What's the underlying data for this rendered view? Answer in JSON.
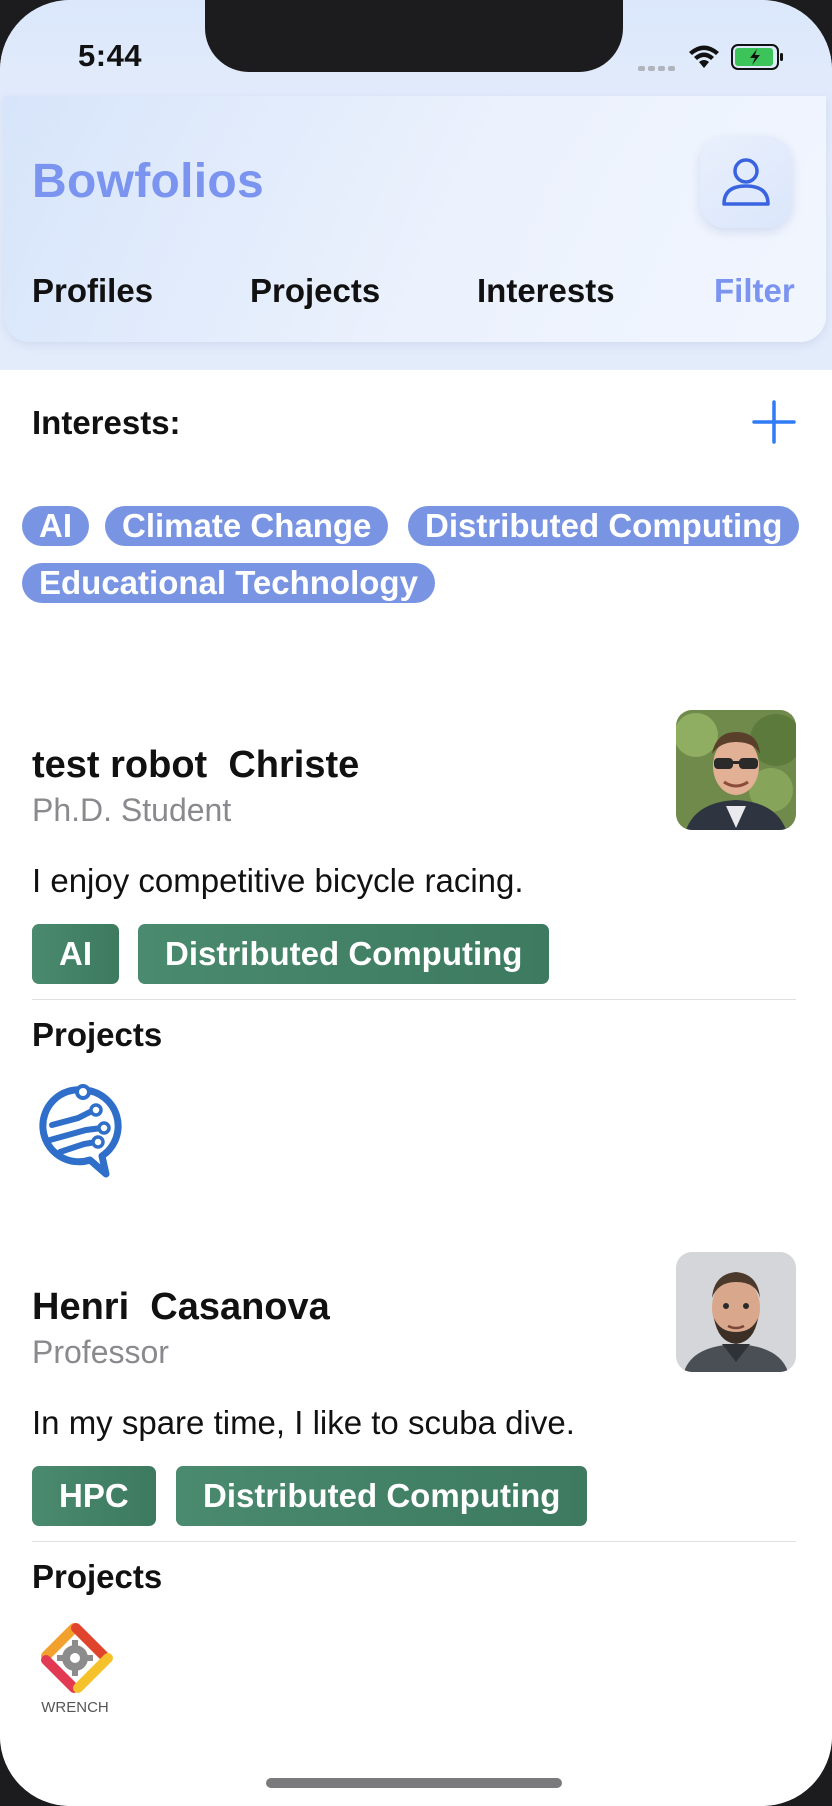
{
  "status_bar": {
    "time": "5:44"
  },
  "header": {
    "app_title": "Bowfolios",
    "tabs": [
      {
        "label": "Profiles"
      },
      {
        "label": "Projects"
      },
      {
        "label": "Interests"
      },
      {
        "label": "Filter"
      }
    ],
    "active_tab": "Filter"
  },
  "filter": {
    "interests_label": "Interests:",
    "selected_interests": [
      "AI",
      "Climate Change",
      "Distributed Computing",
      "Educational Technology"
    ]
  },
  "profiles": [
    {
      "name": "test robot  Christe",
      "title": "Ph.D. Student",
      "bio": "I enjoy competitive bicycle racing.",
      "interests": [
        "AI",
        "Distributed Computing"
      ],
      "projects_label": "Projects"
    },
    {
      "name": "Henri  Casanova",
      "title": "Professor",
      "bio": "In my spare time, I like to scuba dive.",
      "interests": [
        "HPC",
        "Distributed Computing"
      ],
      "projects_label": "Projects",
      "project_logo_text": "WRENCH"
    }
  ],
  "colors": {
    "accent": "#7a94f0",
    "chip": "#7a94e4",
    "tag": "#3d7a60",
    "add_button": "#2f7cf6"
  }
}
